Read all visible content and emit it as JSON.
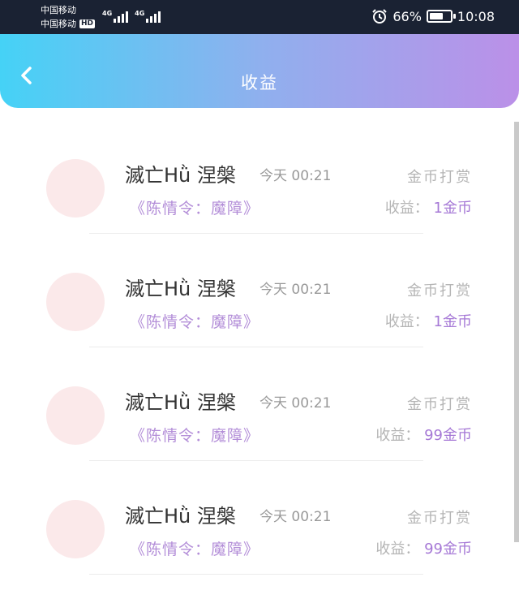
{
  "status_bar": {
    "carrier_1": "中国移动",
    "carrier_2": "中国移动",
    "hd_badge": "HD",
    "signal_1": "4G",
    "signal_2": "4G",
    "battery_percent": "66%",
    "time": "10:08",
    "battery_level": 0.66
  },
  "header": {
    "title": "收益",
    "back_icon": "chevron-left-icon"
  },
  "records": [
    {
      "username": "滅亡Hǜ 涅槃",
      "time": "今天  00:21",
      "type": "金币打赏",
      "book": "《陈情令：魔障》",
      "income_label": "收益：",
      "income_value": "1金币"
    },
    {
      "username": "滅亡Hǜ 涅槃",
      "time": "今天  00:21",
      "type": "金币打赏",
      "book": "《陈情令：魔障》",
      "income_label": "收益：",
      "income_value": "1金币"
    },
    {
      "username": "滅亡Hǜ 涅槃",
      "time": "今天  00:21",
      "type": "金币打赏",
      "book": "《陈情令：魔障》",
      "income_label": "收益：",
      "income_value": "99金币"
    },
    {
      "username": "滅亡Hǜ 涅槃",
      "time": "今天  00:21",
      "type": "金币打赏",
      "book": "《陈情令：魔障》",
      "income_label": "收益：",
      "income_value": "99金币"
    }
  ],
  "colors": {
    "accent": "#a679d6",
    "header_gradient_start": "#45d2f6",
    "header_gradient_end": "#bb90e8"
  }
}
